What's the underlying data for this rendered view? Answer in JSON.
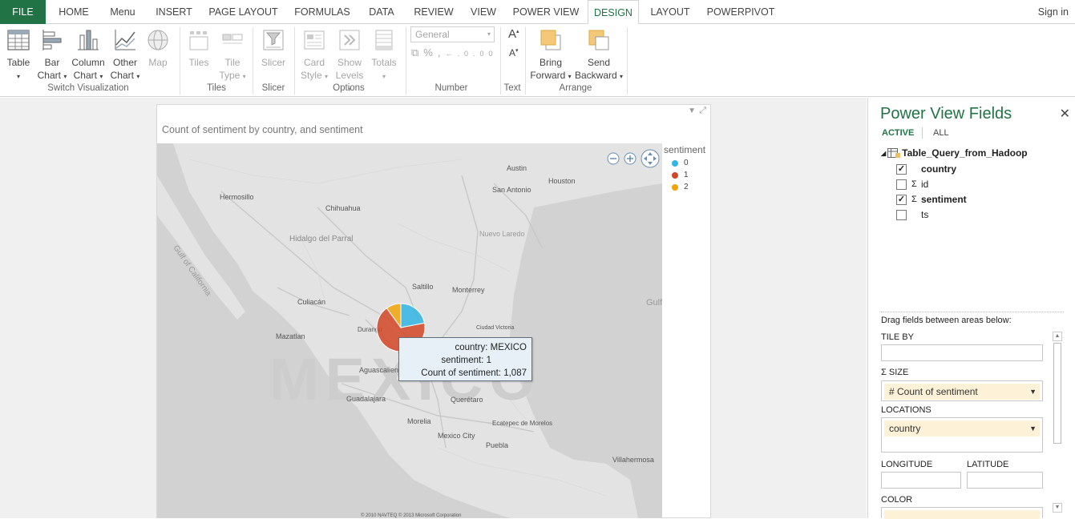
{
  "ribbon_tabs": [
    {
      "label": "FILE"
    },
    {
      "label": "HOME"
    },
    {
      "label": "Menu"
    },
    {
      "label": "INSERT"
    },
    {
      "label": "PAGE LAYOUT"
    },
    {
      "label": "FORMULAS"
    },
    {
      "label": "DATA"
    },
    {
      "label": "REVIEW"
    },
    {
      "label": "VIEW"
    },
    {
      "label": "POWER VIEW"
    },
    {
      "label": "DESIGN"
    },
    {
      "label": "LAYOUT"
    },
    {
      "label": "POWERPIVOT"
    }
  ],
  "signin": "Sign in",
  "ribbon": {
    "table": [
      "Table",
      ""
    ],
    "bar": [
      "Bar",
      "Chart"
    ],
    "column": [
      "Column",
      "Chart"
    ],
    "other": [
      "Other",
      "Chart"
    ],
    "map": "Map",
    "tiles": "Tiles",
    "tile_type": [
      "Tile",
      "Type"
    ],
    "slicer": "Slicer",
    "card_style": [
      "Card",
      "Style"
    ],
    "show_levels": [
      "Show",
      "Levels"
    ],
    "totals": "Totals",
    "number_format": "General",
    "bring_forward": [
      "Bring",
      "Forward"
    ],
    "send_backward": [
      "Send",
      "Backward"
    ],
    "groups": {
      "switch": "Switch Visualization",
      "tiles": "Tiles",
      "slicer": "Slicer",
      "options": "Options",
      "number": "Number",
      "text": "Text",
      "arrange": "Arrange"
    }
  },
  "viz": {
    "title": "Count of sentiment by country, and sentiment",
    "legend_title": "sentiment",
    "legend": [
      {
        "label": "0",
        "color": "#33b5e5"
      },
      {
        "label": "1",
        "color": "#d24726"
      },
      {
        "label": "2",
        "color": "#f0a30a"
      }
    ],
    "map_labels": {
      "mexico": "MEXICO",
      "hermosillo": "Hermosillo",
      "chihuahua": "Chihuahua",
      "austin": "Austin",
      "houston": "Houston",
      "san_antonio": "San Antonio",
      "culiacan": "Culiacán",
      "saltillo": "Saltillo",
      "monterrey": "Monterrey",
      "durango": "Durango",
      "mazatlan": "Mazatlan",
      "aguascalientes": "Aguascalientes",
      "guadalajara": "Guadalajara",
      "queretaro": "Querétaro",
      "morelia": "Morelia",
      "mexico_city": "Mexico City",
      "puebla": "Puebla",
      "villahermosa": "Villahermosa",
      "ecatepec": "Ecatepec de Morelos",
      "gulf": "Gulf",
      "gulf_california": "Gulf of California",
      "hidalgo": "Hidalgo del Parral",
      "ciudad_victoria": "Ciudad Victoria",
      "nuevo_laredo": "Nuevo Laredo",
      "copyright": "© 2010 NAVTEQ  © 2013 Microsoft Corporation"
    },
    "pie": {
      "country": "MEXICO",
      "slices": [
        {
          "sentiment": "0",
          "color": "#33b5e5",
          "fraction": 0.22
        },
        {
          "sentiment": "1",
          "color": "#d24726",
          "fraction": 0.68
        },
        {
          "sentiment": "2",
          "color": "#f0a30a",
          "fraction": 0.1
        }
      ]
    },
    "tooltip": {
      "country_label": "country:",
      "country_value": "MEXICO",
      "sentiment_label": "sentiment:",
      "sentiment_value": "1",
      "count_label": "Count of sentiment:",
      "count_value": "1,087"
    }
  },
  "fields": {
    "title": "Power View Fields",
    "tab_active": "ACTIVE",
    "tab_all": "ALL",
    "table_name": "Table_Query_from_Hadoop",
    "items": [
      {
        "label": "country",
        "checked": true,
        "sigma": false
      },
      {
        "label": "id",
        "checked": false,
        "sigma": true
      },
      {
        "label": "sentiment",
        "checked": true,
        "sigma": true
      },
      {
        "label": "ts",
        "checked": false,
        "sigma": false
      }
    ],
    "drag_hint": "Drag fields between areas below:",
    "tile_by": "TILE BY",
    "size": "SIZE",
    "size_value": "# Count of sentiment",
    "locations": "LOCATIONS",
    "locations_value": "country",
    "longitude": "LONGITUDE",
    "latitude": "LATITUDE",
    "color": "COLOR"
  }
}
